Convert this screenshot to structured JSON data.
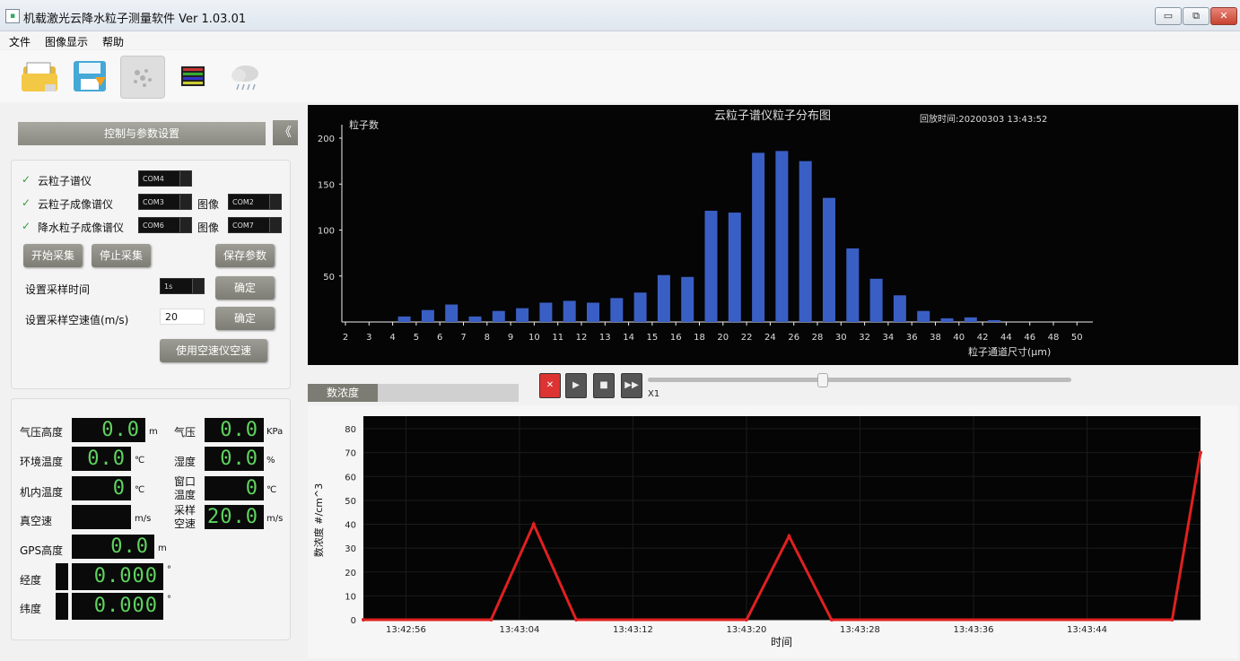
{
  "window": {
    "title": "机载激光云降水粒子测量软件 Ver 1.03.01",
    "min_label": "▭",
    "max_label": "⧉",
    "close_label": "✕"
  },
  "menu": [
    "文件",
    "图像显示",
    "帮助"
  ],
  "toolbar": {
    "icons": [
      "open-folder-icon",
      "save-disk-icon",
      "particles-icon",
      "color-scale-icon",
      "cloud-rain-icon"
    ]
  },
  "control": {
    "header": "控制与参数设置",
    "collapse_label": "《",
    "check_mark": "✓",
    "instruments": [
      {
        "label": "云粒子谱仪",
        "port": "COM4"
      },
      {
        "label": "云粒子成像谱仪",
        "port": "COM3",
        "image_label": "图像",
        "image_port": "COM2"
      },
      {
        "label": "降水粒子成像谱仪",
        "port": "COM6",
        "image_label": "图像",
        "image_port": "COM7"
      }
    ],
    "start_button": "开始采集",
    "stop_button": "停止采集",
    "save_button": "保存参数",
    "sample_time_label": "设置采样时间",
    "sample_time_value": "1s",
    "confirm_button": "确定",
    "airspeed_label": "设置采样空速值(m/s)",
    "airspeed_value": "20",
    "use_airspeed_button": "使用空速仪空速"
  },
  "gauges": {
    "pressure_altitude": {
      "label": "气压高度",
      "value": "0.0",
      "unit": "m"
    },
    "pressure": {
      "label": "气压",
      "value": "0.0",
      "unit": "KPa"
    },
    "ambient_temp": {
      "label": "环境温度",
      "value": "0.0",
      "unit": "℃"
    },
    "humidity": {
      "label": "湿度",
      "value": "0.0",
      "unit": "%"
    },
    "internal_temp": {
      "label": "机内温度",
      "value": "0",
      "unit": "℃"
    },
    "window_temp": {
      "label_line1": "窗口",
      "label_line2": "温度",
      "value": "0",
      "unit": "℃"
    },
    "true_airspeed": {
      "label": "真空速",
      "value": "",
      "unit": "m/s"
    },
    "sample_airspeed": {
      "label_line1": "采样",
      "label_line2": "空速",
      "value": "20.0",
      "unit": "m/s"
    },
    "gps_altitude": {
      "label": "GPS高度",
      "value": "0.0",
      "unit": "m"
    },
    "longitude": {
      "label": "经度",
      "value": "0.000",
      "unit": "°"
    },
    "latitude": {
      "label": "纬度",
      "value": "0.000",
      "unit": "°"
    }
  },
  "player": {
    "speed_label": "X1",
    "slider_fraction": 0.41
  },
  "conc_tab_label": "数浓度",
  "colors": {
    "bar": "#3a5fc4",
    "line": "#e02020",
    "gauge_text": "#5fd35f"
  },
  "chart_data": [
    {
      "type": "bar",
      "title": "云粒子谱仪粒子分布图",
      "timestamp": "回放时间:20200303 13:43:52",
      "ylabel": "粒子数",
      "xlabel": "粒子通道尺寸(μm)",
      "ylim": [
        0,
        200
      ],
      "yticks": [
        50,
        100,
        150,
        200
      ],
      "categories": [
        "2",
        "3",
        "4",
        "5",
        "6",
        "7",
        "8",
        "9",
        "10",
        "11",
        "12",
        "13",
        "14",
        "15",
        "16",
        "18",
        "20",
        "22",
        "24",
        "26",
        "28",
        "30",
        "32",
        "34",
        "36",
        "38",
        "40",
        "42",
        "44",
        "46",
        "48",
        "50"
      ],
      "values": [
        0,
        0,
        6,
        13,
        19,
        6,
        12,
        15,
        21,
        23,
        21,
        26,
        32,
        51,
        49,
        121,
        119,
        184,
        186,
        175,
        135,
        80,
        47,
        29,
        12,
        4,
        5,
        2,
        0,
        0,
        0,
        0
      ]
    },
    {
      "type": "line",
      "title": "",
      "ylabel": "数浓度 #/cm^3",
      "xlabel": "时间",
      "ylim": [
        0,
        80
      ],
      "yticks": [
        0,
        10,
        20,
        30,
        40,
        50,
        60,
        70,
        80
      ],
      "xticks": [
        "13:42:56",
        "13:43:04",
        "13:43:12",
        "13:43:20",
        "13:43:28",
        "13:43:36",
        "13:43:44"
      ],
      "x_range": [
        "13:42:53",
        "13:43:52"
      ],
      "series": [
        {
          "x": [
            "13:42:53",
            "13:43:02",
            "13:43:05",
            "13:43:08",
            "13:43:20",
            "13:43:23",
            "13:43:26",
            "13:43:50",
            "13:43:52"
          ],
          "y": [
            0,
            0,
            40,
            0,
            0,
            35,
            0,
            0,
            70
          ]
        }
      ]
    }
  ]
}
